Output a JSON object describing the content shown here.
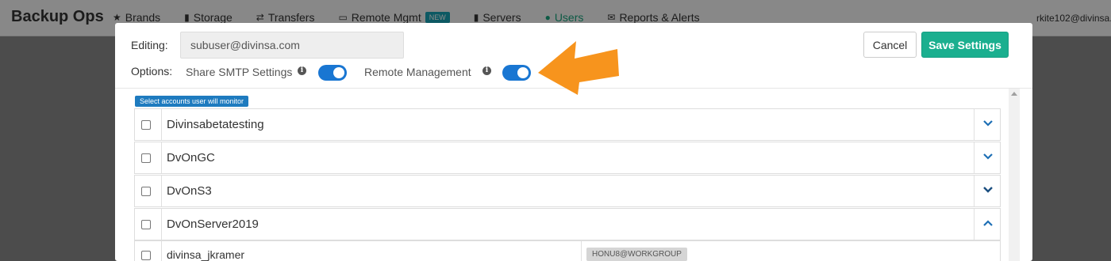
{
  "app": {
    "title": "Backup Ops",
    "user_email": "rkite102@divinsa.c"
  },
  "nav": {
    "items": [
      {
        "label": "Brands",
        "icon": "star-icon",
        "glyph": "★"
      },
      {
        "label": "Storage",
        "icon": "bar-chart-icon",
        "glyph": "▮"
      },
      {
        "label": "Transfers",
        "icon": "exchange-icon",
        "glyph": "⇄"
      },
      {
        "label": "Remote Mgmt",
        "icon": "monitor-icon",
        "glyph": "▭",
        "badge": "NEW"
      },
      {
        "label": "Servers",
        "icon": "signal-icon",
        "glyph": "▮"
      },
      {
        "label": "Users",
        "icon": "users-icon",
        "glyph": "●",
        "active": true
      },
      {
        "label": "Reports & Alerts",
        "icon": "envelope-icon",
        "glyph": "✉"
      }
    ]
  },
  "modal": {
    "editing_label": "Editing:",
    "editing_value": "subuser@divinsa.com",
    "options_label": "Options:",
    "options": [
      {
        "label": "Share SMTP Settings",
        "enabled": true
      },
      {
        "label": "Remote Management",
        "enabled": true
      }
    ],
    "cancel_label": "Cancel",
    "save_label": "Save Settings",
    "monitor_badge": "Select accounts user will monitor",
    "accounts": [
      {
        "name": "Divinsabetatesting",
        "expanded": false
      },
      {
        "name": "DvOnGC",
        "expanded": false
      },
      {
        "name": "DvOnS3",
        "expanded": false
      },
      {
        "name": "DvOnServer2019",
        "expanded": true
      }
    ],
    "sub_rows": [
      {
        "user": "divinsa_jkramer",
        "host": "HONU8@WORKGROUP"
      }
    ]
  },
  "colors": {
    "accent": "#1aaf8f",
    "toggle_on": "#1976d2",
    "badge_blue": "#1e7bbf",
    "arrow": "#f7941d",
    "chevron": "#1e6fb5"
  }
}
